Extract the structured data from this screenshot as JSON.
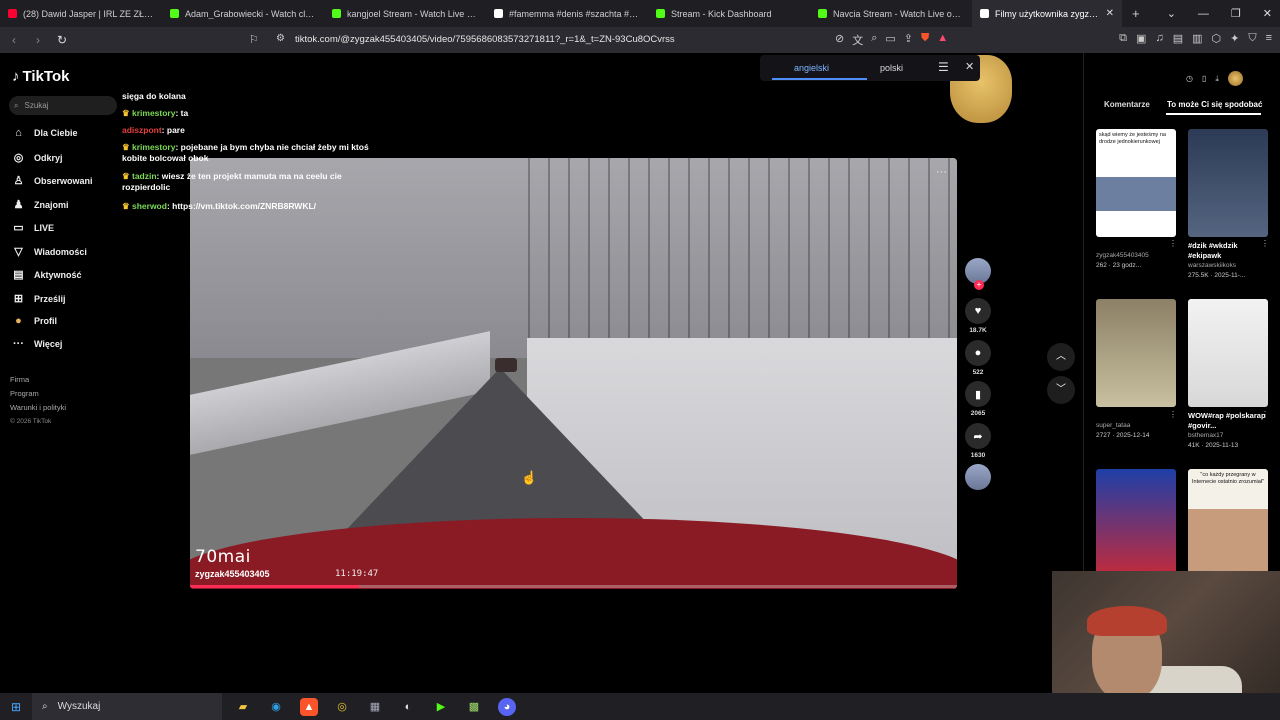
{
  "browser": {
    "tabs": [
      {
        "title": "(28) Dawid Jasper | IRL ZE ZŁOTYCH",
        "color": "#ff0033"
      },
      {
        "title": "Adam_Grabowiecki - Watch clips",
        "color": "#53fc18"
      },
      {
        "title": "kangjoel Stream - Watch Live on Kick",
        "color": "#53fc18"
      },
      {
        "title": "#famemma #denis #szachta #shorts",
        "color": "#ffffff"
      },
      {
        "title": "Stream - Kick Dashboard",
        "color": "#53fc18"
      },
      {
        "title": "Navcia Stream - Watch Live on Kick",
        "color": "#53fc18"
      },
      {
        "title": "Filmy użytkownika zygzak (@",
        "color": "#ffffff"
      }
    ],
    "new_tab": "+",
    "url": "tiktok.com/@zygzak455403405/video/7595686083573271811?_r=1&_t=ZN-93Cu8OCvrss"
  },
  "sidebar": {
    "logo": "TikTok",
    "search_placeholder": "Szukaj",
    "items": [
      {
        "label": "Dla Ciebie",
        "icon": "home-icon"
      },
      {
        "label": "Odkryj",
        "icon": "compass-icon"
      },
      {
        "label": "Obserwowani",
        "icon": "following-icon"
      },
      {
        "label": "Znajomi",
        "icon": "friends-icon"
      },
      {
        "label": "LIVE",
        "icon": "live-icon"
      },
      {
        "label": "Wiadomości",
        "icon": "send-icon"
      },
      {
        "label": "Aktywność",
        "icon": "activity-icon"
      },
      {
        "label": "Prześlij",
        "icon": "upload-icon"
      },
      {
        "label": "Profil",
        "icon": "profile-icon"
      },
      {
        "label": "Więcej",
        "icon": "more-icon"
      }
    ],
    "footer": [
      "Firma",
      "Program",
      "Warunki i polityki"
    ],
    "copyright": "© 2026 TikTok"
  },
  "chat": {
    "lines": [
      {
        "user": "",
        "text": "sięga do kolana"
      },
      {
        "user": "krimestory",
        "text": "ta"
      },
      {
        "user": "adiszpont",
        "text": "pare",
        "red": true
      },
      {
        "user": "krimestory",
        "text": "pojebane ja bym chyba nie chciał żeby mi ktoś kobite bolcował obok"
      },
      {
        "user": "tadzin",
        "text": "wiesz że ten projekt mamuta ma na ceelu cie rozpierdolic"
      },
      {
        "user": "sherwod",
        "text": "https://vm.tiktok.com/ZNRB8RWKL/"
      }
    ]
  },
  "video": {
    "brand": "70mai",
    "author": "zygzak455403405",
    "timestamp": "11:19:47",
    "progress": 0.22
  },
  "actions": {
    "likes": "18.7K",
    "comments": "522",
    "saves": "2065",
    "shares": "1630"
  },
  "translate": {
    "opt1": "angielski",
    "opt2": "polski"
  },
  "right_panel": {
    "tab_comments": "Komentarze",
    "tab_suggest": "To może Ci się spodobać",
    "cards": [
      {
        "overlay": "skąd wiemy że jesteśmy na drodze jednokierunkowej",
        "title": "",
        "author": "zygzak455403405",
        "stats": "262 · 23 godz..."
      },
      {
        "overlay": "",
        "title": "#dzik #wkdzik #ekipawk",
        "author": "warszawskiikoks",
        "stats": "275.5K · 2025-11-..."
      },
      {
        "overlay": "",
        "title": "",
        "author": "super_tataa",
        "stats": "2727 · 2025-12-14"
      },
      {
        "overlay": "",
        "title": "WOW#rap #polskarap #govir...",
        "author": "bsthemax17",
        "stats": "41K · 2025-11-13"
      },
      {
        "overlay": "",
        "title": "",
        "author": "",
        "stats": ""
      },
      {
        "overlay": "\"co każdy przegrany w Internecie ostatnio zrozumiał\"",
        "title": "",
        "author": "",
        "stats": ""
      }
    ]
  },
  "taskbar": {
    "search_placeholder": "Wyszukaj"
  }
}
